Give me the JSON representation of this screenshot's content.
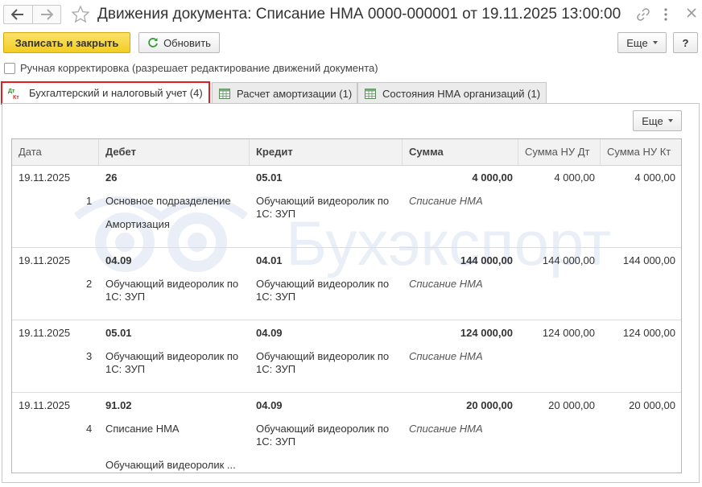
{
  "window": {
    "title": "Движения документа: Списание НМА 0000-000001 от 19.11.2025 13:00:00"
  },
  "toolbar": {
    "save_close_label": "Записать и закрыть",
    "refresh_label": "Обновить",
    "more_label": "Еще",
    "help_label": "?"
  },
  "manual_edit": {
    "label": "Ручная корректировка (разрешает редактирование движений документа)",
    "checked": false
  },
  "tabs": [
    {
      "label": "Бухгалтерский и налоговый учет (4)",
      "active": true
    },
    {
      "label": "Расчет амортизации (1)",
      "active": false
    },
    {
      "label": "Состояния НМА организаций (1)",
      "active": false
    }
  ],
  "panel": {
    "more_label": "Еще"
  },
  "table": {
    "columns": [
      "Дата",
      "Дебет",
      "Кредит",
      "Сумма",
      "Сумма НУ Дт",
      "Сумма НУ Кт"
    ],
    "records": [
      {
        "date": "19.11.2025",
        "num": "1",
        "debit_account": "26",
        "debit_sub1": "Основное подразделение",
        "debit_sub2": "Амортизация",
        "credit_account": "05.01",
        "credit_sub": "Обучающий видеоролик по 1С: ЗУП",
        "sum": "4 000,00",
        "content": "Списание НМА",
        "nu_dt": "4 000,00",
        "nu_kt": "4 000,00"
      },
      {
        "date": "19.11.2025",
        "num": "2",
        "debit_account": "04.09",
        "debit_sub1": "Обучающий видеоролик по 1С: ЗУП",
        "debit_sub2": "",
        "credit_account": "04.01",
        "credit_sub": "Обучающий видеоролик по 1С: ЗУП",
        "sum": "144 000,00",
        "content": "Списание НМА",
        "nu_dt": "144 000,00",
        "nu_kt": "144 000,00"
      },
      {
        "date": "19.11.2025",
        "num": "3",
        "debit_account": "05.01",
        "debit_sub1": "Обучающий видеоролик по 1С: ЗУП",
        "debit_sub2": "",
        "credit_account": "04.09",
        "credit_sub": "Обучающий видеоролик по 1С: ЗУП",
        "sum": "124 000,00",
        "content": "Списание НМА",
        "nu_dt": "124 000,00",
        "nu_kt": "124 000,00"
      },
      {
        "date": "19.11.2025",
        "num": "4",
        "debit_account": "91.02",
        "debit_sub1": "Списание НМА",
        "debit_sub2": "Обучающий видеоролик ...",
        "credit_account": "04.09",
        "credit_sub": "Обучающий видеоролик по 1С: ЗУП",
        "sum": "20 000,00",
        "content": "Списание НМА",
        "nu_dt": "20 000,00",
        "nu_kt": "20 000,00"
      }
    ]
  },
  "watermark": {
    "text": "Бухэкспорт"
  },
  "icons": {
    "back": "arrow-left-icon",
    "forward": "arrow-right-icon",
    "favorite": "star-icon",
    "link": "link-icon",
    "more": "more-vertical-icon",
    "close": "close-icon",
    "refresh": "refresh-icon",
    "dtkt": "dt-kt-icon",
    "table": "table-icon"
  },
  "colors": {
    "primary_button": "#f2cd24",
    "active_tab_highlight": "#e11f1f",
    "watermark": "#eef2f8"
  }
}
